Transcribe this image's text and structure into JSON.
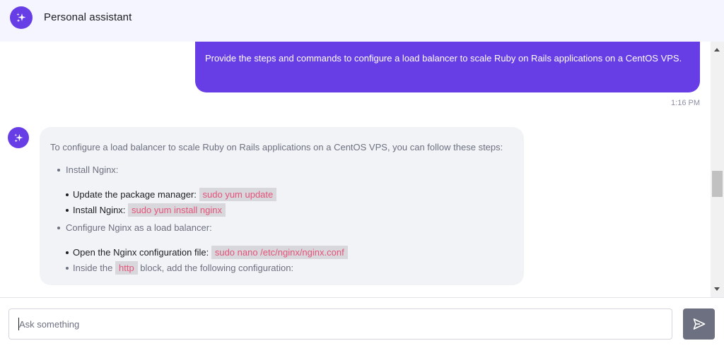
{
  "header": {
    "title": "Personal assistant",
    "icon": "sparkles-icon"
  },
  "messages": {
    "user": {
      "text": "Provide the steps and commands to configure a load balancer to scale Ruby on Rails applications on a CentOS VPS.",
      "time": "1:16 PM"
    },
    "assistant": {
      "intro": "To configure a load balancer to scale Ruby on Rails applications on a CentOS VPS, you can follow these steps:",
      "steps": [
        {
          "label": "Install Nginx:",
          "substeps": [
            {
              "text": "Update the package manager: ",
              "code": "sudo yum update"
            },
            {
              "text": "Install Nginx: ",
              "code": "sudo yum install nginx"
            }
          ]
        },
        {
          "label": "Configure Nginx as a load balancer:",
          "substeps": [
            {
              "text": "Open the Nginx configuration file: ",
              "code": "sudo nano /etc/nginx/nginx.conf"
            },
            {
              "text": "Inside the ",
              "code": "http",
              "suffix": " block, add the following configuration:"
            }
          ]
        }
      ]
    }
  },
  "composer": {
    "placeholder": "Ask something",
    "send_icon": "send-icon"
  },
  "colors": {
    "accent": "#673de6",
    "code": "#e5527a",
    "bubble": "#f2f3f6",
    "send": "#6d7081"
  }
}
